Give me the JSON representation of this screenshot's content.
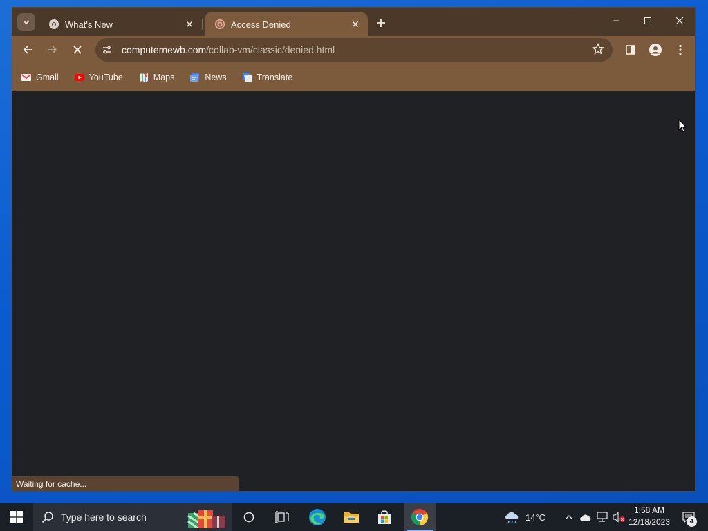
{
  "browser": {
    "tabs": [
      {
        "title": "What's New",
        "favicon": "chrome-icon",
        "active": false
      },
      {
        "title": "Access Denied",
        "favicon": "collabvm-icon",
        "active": true
      }
    ],
    "url_host": "computernewb.com",
    "url_path": "/collab-vm/classic/denied.html",
    "bookmarks": [
      {
        "label": "Gmail",
        "icon": "gmail-icon"
      },
      {
        "label": "YouTube",
        "icon": "youtube-icon"
      },
      {
        "label": "Maps",
        "icon": "maps-icon"
      },
      {
        "label": "News",
        "icon": "news-icon"
      },
      {
        "label": "Translate",
        "icon": "translate-icon"
      }
    ],
    "status_text": "Waiting for cache...",
    "theme_color": "#7b5b3c"
  },
  "taskbar": {
    "search_placeholder": "Type here to search",
    "weather_temp": "14°C",
    "clock_time": "1:58 AM",
    "clock_date": "12/18/2023",
    "notification_count": "4"
  }
}
